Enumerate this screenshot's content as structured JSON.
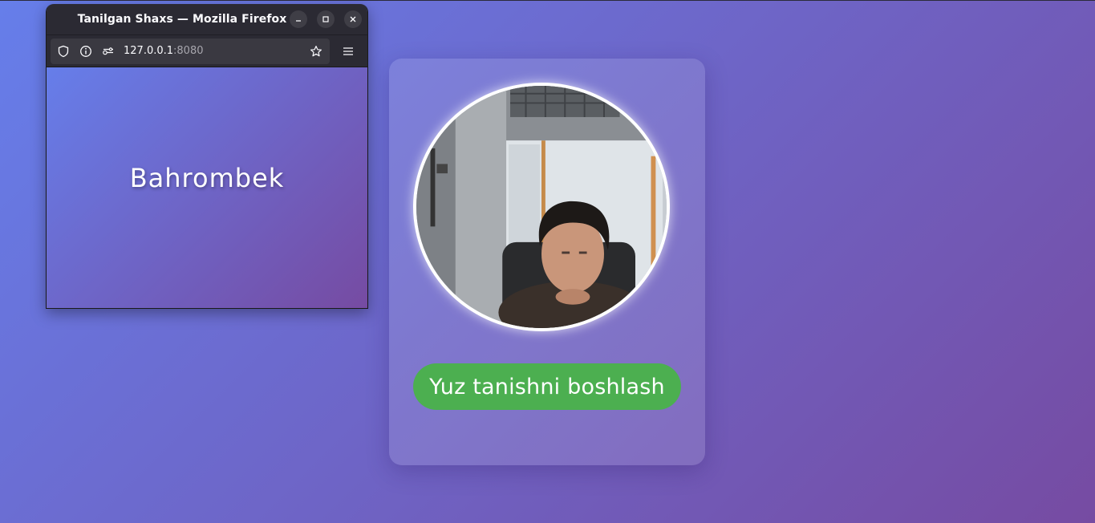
{
  "window": {
    "title": "Tanilgan Shaxs — Mozilla Firefox",
    "controls": [
      "minimize-icon",
      "maximize-icon",
      "close-icon"
    ]
  },
  "urlbar": {
    "host": "127.0.0.1",
    "port": ":8080",
    "icons": [
      "shield-icon",
      "info-icon",
      "permissions-icon",
      "star-icon"
    ]
  },
  "popup": {
    "recognized_name": "Bahrombek"
  },
  "card": {
    "camera_feed": "webcam-video",
    "start_button_label": "Yuz tanishni boshlash"
  },
  "colors": {
    "background_start": "#667eea",
    "background_end": "#764ba2",
    "button": "#4caf50",
    "firefox_chrome": "#2b2a33"
  }
}
